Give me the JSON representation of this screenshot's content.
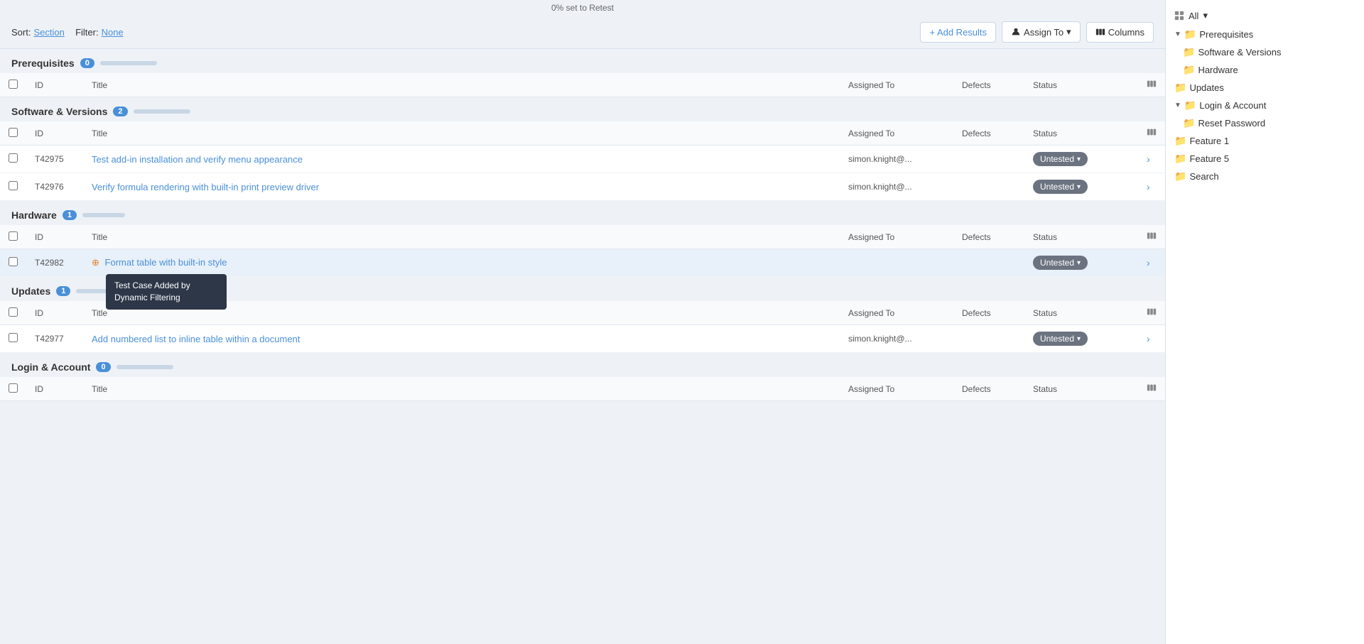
{
  "topNotice": "0% set to Retest",
  "toolbar": {
    "sortLabel": "Sort:",
    "sortValue": "Section",
    "filterLabel": "Filter:",
    "filterValue": "None",
    "addResultsLabel": "+ Add Results",
    "assignToLabel": "Assign To",
    "columnsLabel": "Columns"
  },
  "sections": [
    {
      "id": "prerequisites",
      "title": "Prerequisites",
      "badge": "0",
      "hasProgress": true,
      "rows": []
    },
    {
      "id": "software-versions",
      "title": "Software & Versions",
      "badge": "2",
      "hasProgress": true,
      "rows": [
        {
          "id": "T42975",
          "title": "Test add-in installation and verify menu appearance",
          "assignedTo": "simon.knight@...",
          "defects": "",
          "status": "Untested",
          "highlight": false,
          "dynamic": false
        },
        {
          "id": "T42976",
          "title": "Verify formula rendering with built-in print preview driver",
          "assignedTo": "simon.knight@...",
          "defects": "",
          "status": "Untested",
          "highlight": false,
          "dynamic": false
        }
      ]
    },
    {
      "id": "hardware",
      "title": "Hardware",
      "badge": "1",
      "hasProgress": true,
      "rows": [
        {
          "id": "T42982",
          "title": "Format table with built-in style",
          "assignedTo": "",
          "defects": "",
          "status": "Untested",
          "highlight": true,
          "dynamic": true,
          "tooltip": "Test Case Added by Dynamic Filtering"
        }
      ]
    },
    {
      "id": "updates",
      "title": "Updates",
      "badge": "1",
      "hasProgress": true,
      "rows": [
        {
          "id": "T42977",
          "title": "Add numbered list to inline table within a document",
          "assignedTo": "simon.knight@...",
          "defects": "",
          "status": "Untested",
          "highlight": false,
          "dynamic": false
        }
      ]
    },
    {
      "id": "login-account",
      "title": "Login & Account",
      "badge": "0",
      "hasProgress": true,
      "rows": []
    }
  ],
  "tableHeaders": {
    "id": "ID",
    "title": "Title",
    "assignedTo": "Assigned To",
    "defects": "Defects",
    "status": "Status"
  },
  "sidebar": {
    "allLabel": "All",
    "items": [
      {
        "label": "Prerequisites",
        "level": 1,
        "type": "folder",
        "expanded": true
      },
      {
        "label": "Software & Versions",
        "level": 2,
        "type": "folder"
      },
      {
        "label": "Hardware",
        "level": 2,
        "type": "folder"
      },
      {
        "label": "Updates",
        "level": 1,
        "type": "folder"
      },
      {
        "label": "Login & Account",
        "level": 1,
        "type": "folder",
        "expanded": true
      },
      {
        "label": "Reset Password",
        "level": 2,
        "type": "folder"
      },
      {
        "label": "Feature 1",
        "level": 1,
        "type": "folder"
      },
      {
        "label": "Feature 5",
        "level": 1,
        "type": "folder"
      },
      {
        "label": "Search",
        "level": 1,
        "type": "folder"
      }
    ]
  }
}
